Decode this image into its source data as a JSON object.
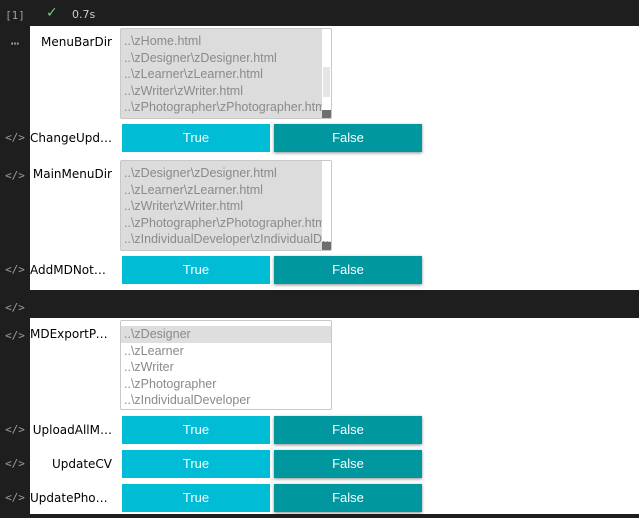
{
  "cell": {
    "execution_count": "[1]",
    "status_icon": "check-icon",
    "check_glyph": "✓",
    "elapsed": "0.7s"
  },
  "gutter": {
    "more_glyph": "⋯",
    "code_glyph": "</>"
  },
  "widgets": {
    "menu_bar_dir": {
      "label": "MenuBarDir",
      "options": [
        "..\\zHome.html",
        "..\\zDesigner\\zDesigner.html",
        "..\\zLearner\\zLearner.html",
        "..\\zWriter\\zWriter.html",
        "..\\zPhotographer\\zPhotographer.html"
      ]
    },
    "change_upd": {
      "label": "ChangeUpd…",
      "true_label": "True",
      "false_label": "False"
    },
    "main_menu_dir": {
      "label": "MainMenuDir",
      "options": [
        "..\\zDesigner\\zDesigner.html",
        "..\\zLearner\\zLearner.html",
        "..\\zWriter\\zWriter.html",
        "..\\zPhotographer\\zPhotographer.html",
        "..\\zIndividualDeveloper\\zIndividualDeveloper.html"
      ]
    },
    "add_md_note": {
      "label": "AddMDNote…",
      "true_label": "True",
      "false_label": "False"
    },
    "md_export_path": {
      "label": "MDExportPath",
      "options": [
        "..\\zDesigner",
        "..\\zLearner",
        "..\\zWriter",
        "..\\zPhotographer",
        "..\\zIndividualDeveloper"
      ],
      "selected": "..\\zDesigner"
    },
    "upload_all": {
      "label": "UploadAllM…",
      "true_label": "True",
      "false_label": "False"
    },
    "update_cv": {
      "label": "UpdateCV",
      "true_label": "True",
      "false_label": "False"
    },
    "update_phot": {
      "label": "UpdatePhot…",
      "true_label": "True",
      "false_label": "False"
    }
  },
  "colors": {
    "true_button": "#00bcd4",
    "false_button": "#00979f",
    "success": "#73c991"
  }
}
